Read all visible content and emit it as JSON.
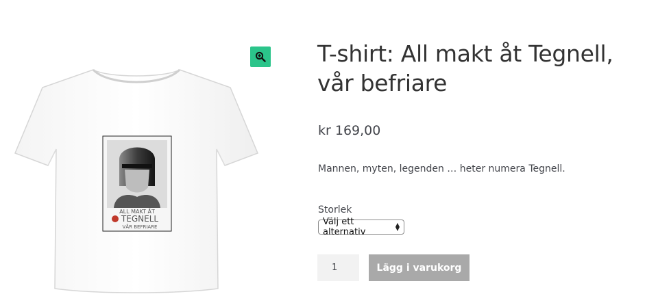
{
  "product": {
    "title": "T-shirt: All makt åt Tegnell, vår befriare",
    "price": "kr 169,00",
    "description": "Mannen, myten, legenden … heter numera Tegnell.",
    "print_text": {
      "line1": "ALL MAKT ÅT",
      "line2": "TEGNELL",
      "line3": "VÅR BEFRIARE"
    }
  },
  "variations": {
    "size_label": "Storlek",
    "size_select_value": "Välj ett alternativ"
  },
  "cart": {
    "quantity": "1",
    "add_to_cart_label": "Lägg i varukorg"
  },
  "icons": {
    "zoom": "zoom-in-icon",
    "select_arrows": "up-down-arrows-icon"
  },
  "colors": {
    "zoom_button": "#2bc48a",
    "add_to_cart_button": "#a9a9a9",
    "title_text": "#333333"
  }
}
